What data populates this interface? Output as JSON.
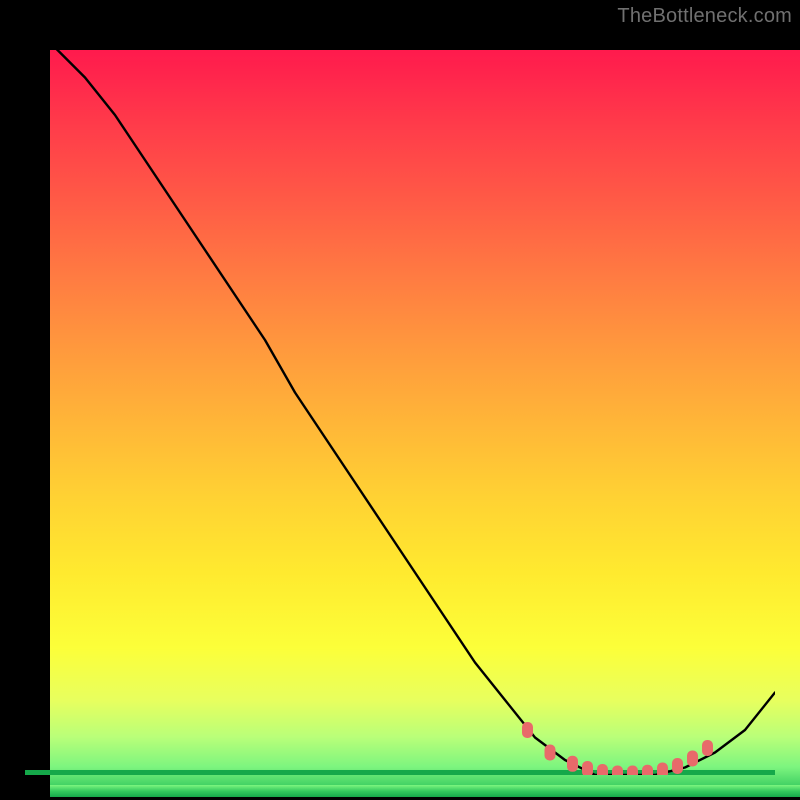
{
  "watermark": "TheBottleneck.com",
  "chart_data": {
    "type": "line",
    "title": "",
    "xlabel": "",
    "ylabel": "",
    "xlim": [
      0,
      100
    ],
    "ylim": [
      0,
      100
    ],
    "series": [
      {
        "name": "bottleneck-curve",
        "x": [
          0,
          4,
          8,
          12,
          16,
          20,
          24,
          28,
          32,
          36,
          40,
          44,
          48,
          52,
          56,
          60,
          64,
          68,
          72,
          76,
          80,
          84,
          88,
          92,
          96,
          100
        ],
        "y": [
          100,
          97,
          93,
          88,
          82,
          76,
          70,
          64,
          58,
          51,
          45,
          39,
          33,
          27,
          21,
          15,
          10,
          5,
          2,
          0,
          0,
          0,
          1,
          3,
          6,
          11
        ]
      }
    ],
    "markers": {
      "name": "highlight-points",
      "x": [
        67,
        70,
        73,
        75,
        77,
        79,
        81,
        83,
        85,
        87,
        89,
        91
      ],
      "y": [
        6,
        3,
        1.5,
        0.8,
        0.4,
        0.2,
        0.2,
        0.3,
        0.6,
        1.2,
        2.2,
        3.6
      ]
    },
    "colors": {
      "curve": "#000000",
      "marker": "#e86a6a",
      "gradient_top": "#ff1a4d",
      "gradient_bottom": "#15a84a"
    }
  }
}
